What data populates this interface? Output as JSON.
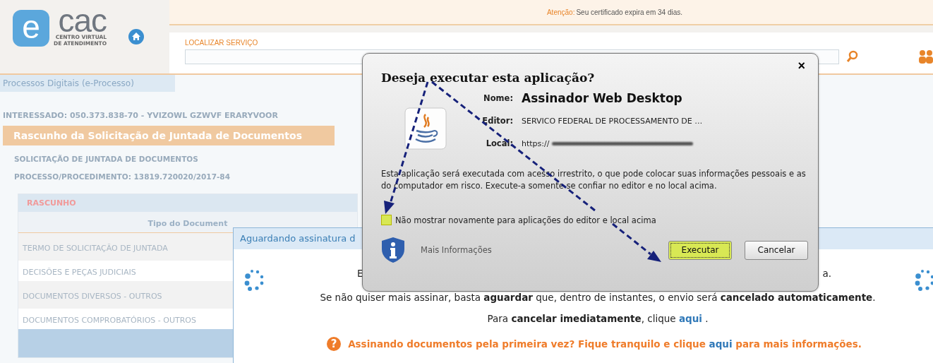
{
  "header": {
    "logo": {
      "mark": "e",
      "wordmark": "cac",
      "tagline": [
        "CENTRO VIRTUAL",
        "DE ATENDIMENTO"
      ]
    },
    "notice": {
      "label": "Atenção:",
      "message": "Seu certificado expira em 34 dias."
    },
    "search": {
      "label": "LOCALIZAR SERVIÇO"
    }
  },
  "breadcrumb": "Processos Digitais (e-Processo)",
  "interessado": "INTERESSADO: 050.373.838-70 - YVIZOWL GZWVF ERARYVOOR",
  "section_title": "Rascunho da Solicitação de Juntada de Documentos",
  "details": [
    "SOLICITAÇÃO DE JUNTADA DE DOCUMENTOS",
    "PROCESSO/PROCEDIMENTO: 13819.720020/2017-84"
  ],
  "table": {
    "caption": "RASCUNHO",
    "columns": [
      "Tipo do Document"
    ],
    "rows": [
      {
        "cells": [
          "TERMO DE SOLICITAÇÃO DE JUNTADA"
        ]
      },
      {
        "cells": [
          "DECISÕES E PEÇAS JUDICIAIS"
        ]
      },
      {
        "cells": [
          "DOCUMENTOS DIVERSOS - OUTROS"
        ]
      },
      {
        "cells": [
          "DOCUMENTOS COMPROBATÓRIOS - OUTROS"
        ]
      }
    ]
  },
  "waiting_dialog": {
    "title": "Aguardando assinatura d",
    "line_1_start": "E",
    "line_1_end": "a.",
    "line_2": "Se não quiser mais assinar, basta **aguardar** que, dentro de instantes, o envio será **cancelado automaticamente**.",
    "line_3": {
      "before": "Para **cancelar imediatamente**, clique ",
      "link": "aqui",
      "after": " ."
    },
    "line_4": {
      "icon": "?",
      "before": "Assinando documentos pela primeira vez? Fique tranquilo e clique ",
      "link": "aqui",
      "after": " para mais informações."
    }
  },
  "java_dialog": {
    "title": "Deseja executar esta aplicação?",
    "close": "×",
    "fields": [
      {
        "kind": "name",
        "label": "Nome:",
        "value": "Assinador Web Desktop"
      },
      {
        "kind": "text",
        "label": "Editor:",
        "value": "SERVICO FEDERAL DE PROCESSAMENTO DE  …"
      },
      {
        "kind": "redacted",
        "label": "Local:",
        "value": "https://"
      }
    ],
    "warning": "Esta aplicação será executada com acesso irrestrito, o que pode colocar suas informações pessoais e as do computador em risco. Execute-a somente se confiar no editor e no local acima.",
    "checkbox": {
      "label": "Não mostrar novamente para aplicações do editor e local acima",
      "checked": false,
      "highlighted": true
    },
    "more_info": "Mais Informações",
    "buttons": [
      {
        "label": "Executar",
        "highlighted": true
      },
      {
        "label": "Cancelar",
        "highlighted": false
      }
    ]
  }
}
